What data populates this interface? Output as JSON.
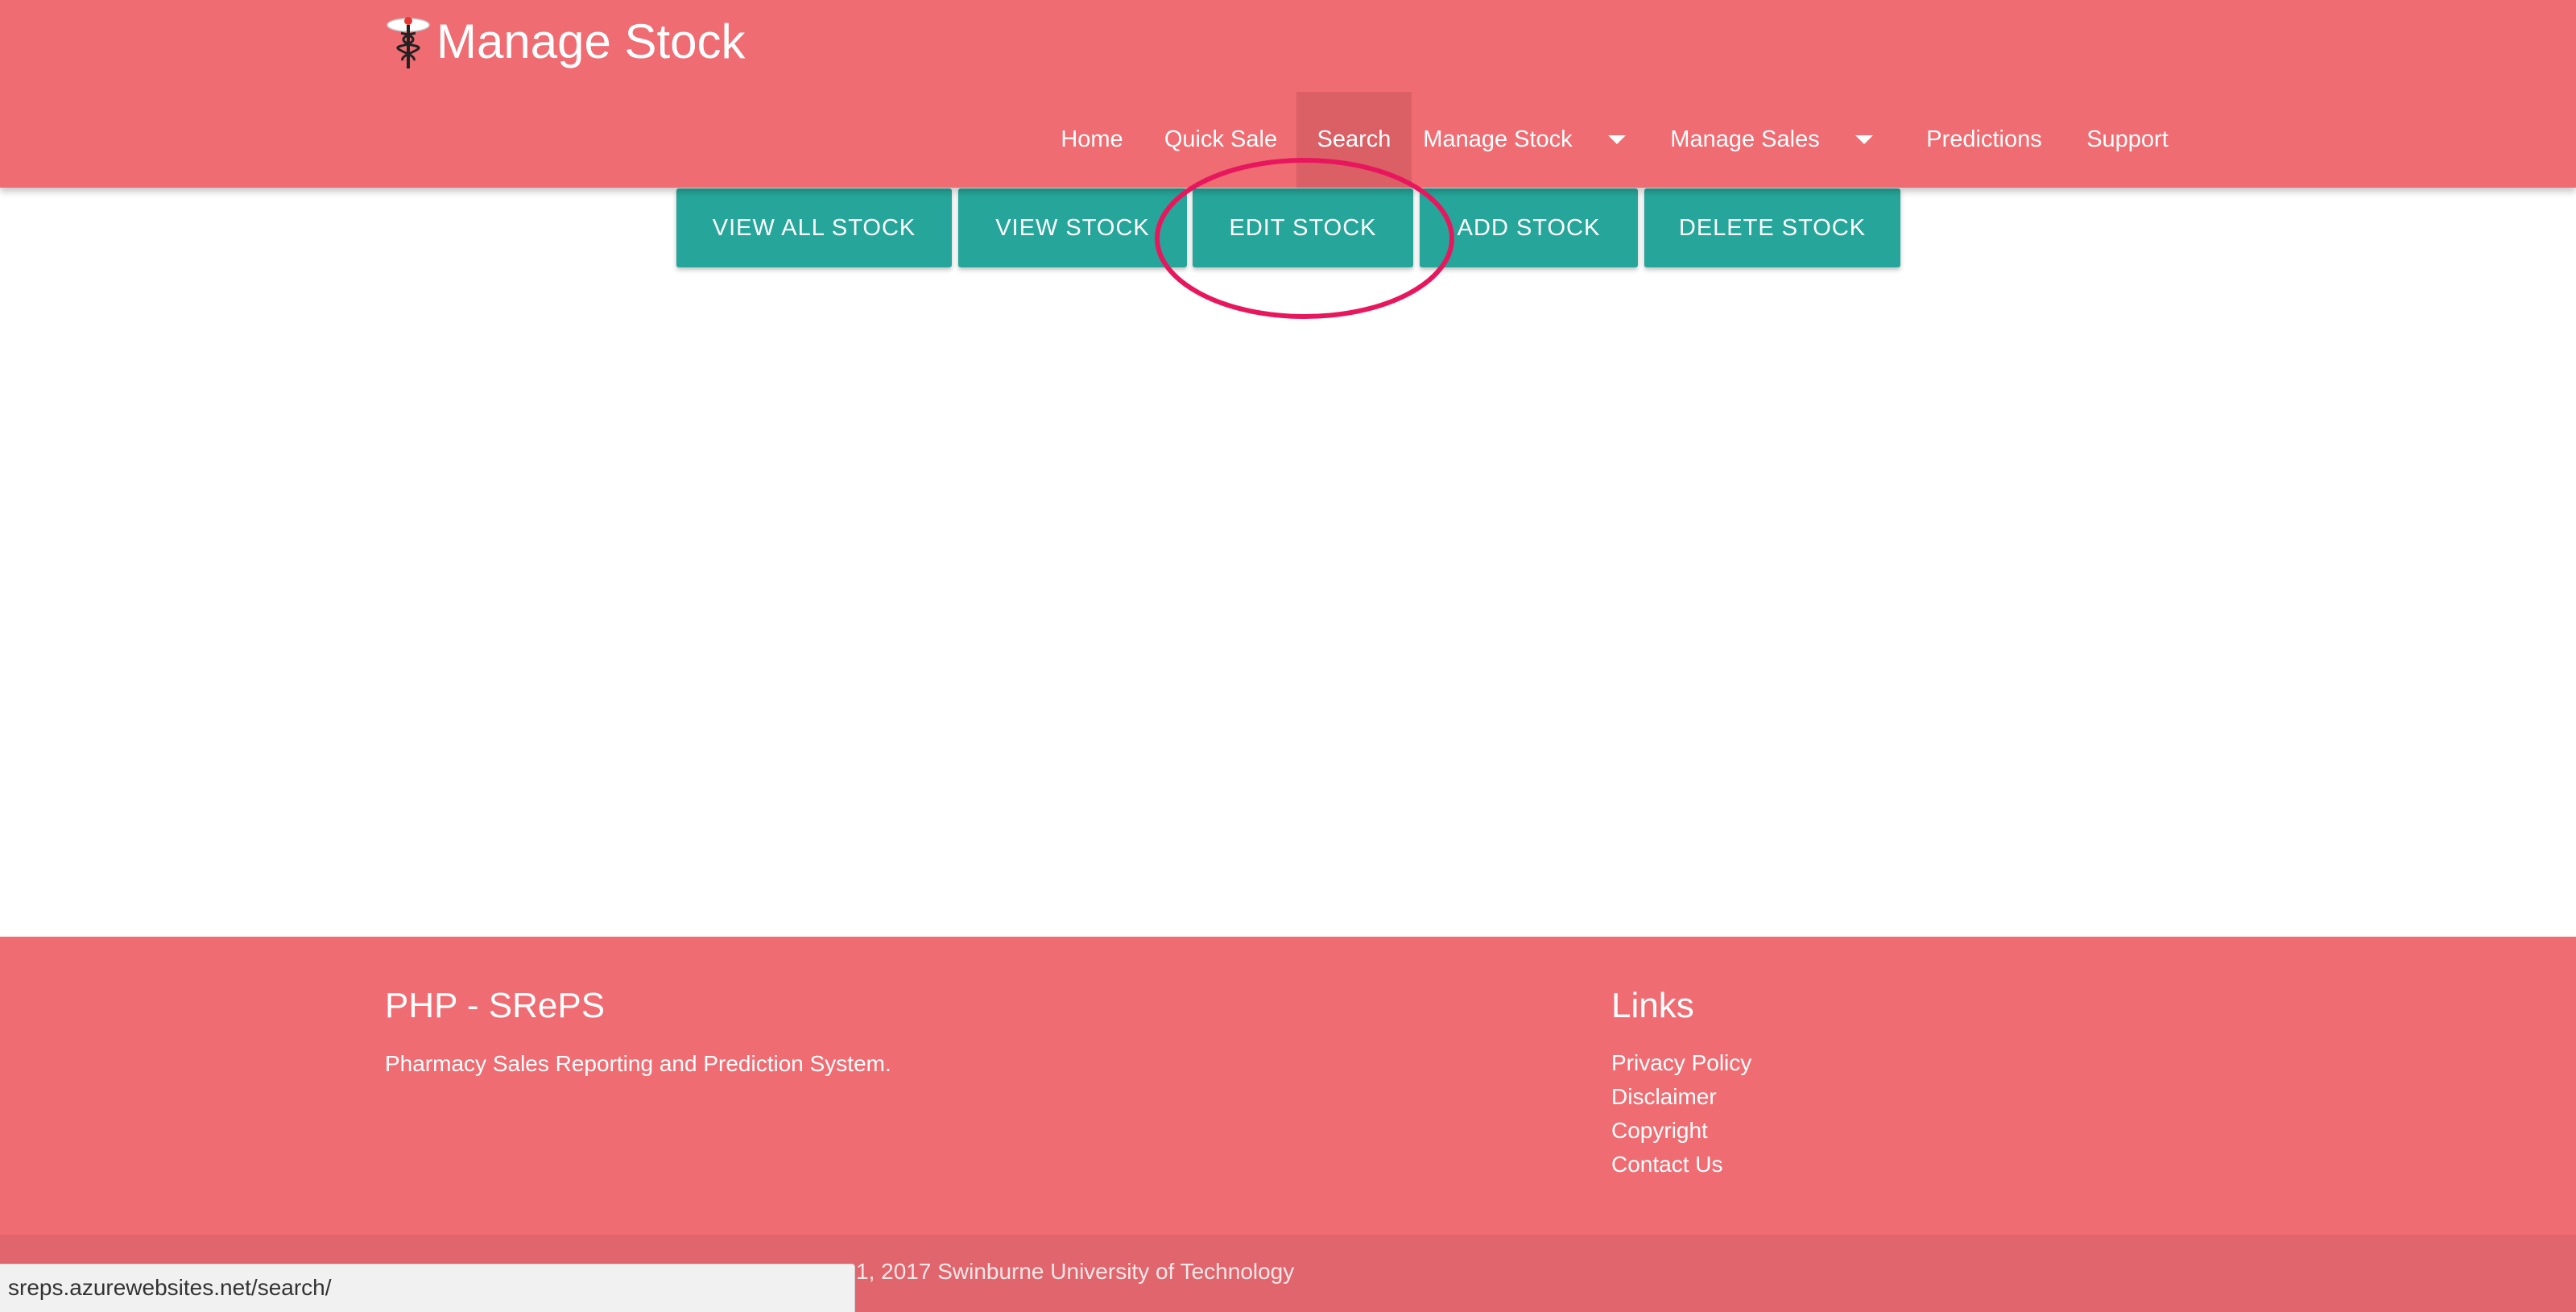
{
  "header": {
    "title": "Manage Stock",
    "logo_icon": "caduceus-icon",
    "background": "#ef6c72"
  },
  "nav": {
    "items": [
      {
        "label": "Home"
      },
      {
        "label": "Quick Sale"
      },
      {
        "label": "Search",
        "active": true
      },
      {
        "label": "Manage Stock",
        "dropdown": true
      },
      {
        "label": "Manage Sales",
        "dropdown": true
      },
      {
        "label": "Predictions"
      },
      {
        "label": "Support"
      }
    ]
  },
  "actions": {
    "view_all": "VIEW ALL STOCK",
    "view": "VIEW STOCK",
    "edit": "EDIT STOCK",
    "add": "ADD STOCK",
    "delete": "DELETE STOCK",
    "button_color": "#26a69a",
    "highlight_color": "#e8175d"
  },
  "footer": {
    "heading": "PHP - SRePS",
    "description": "Pharmacy Sales Reporting and Prediction System.",
    "links_heading": "Links",
    "links": [
      "Privacy Policy",
      "Disclaimer",
      "Copyright",
      "Contact Us"
    ],
    "copyright": "1, 2017 Swinburne University of Technology"
  },
  "statusbar": {
    "url": "sreps.azurewebsites.net/search/"
  }
}
